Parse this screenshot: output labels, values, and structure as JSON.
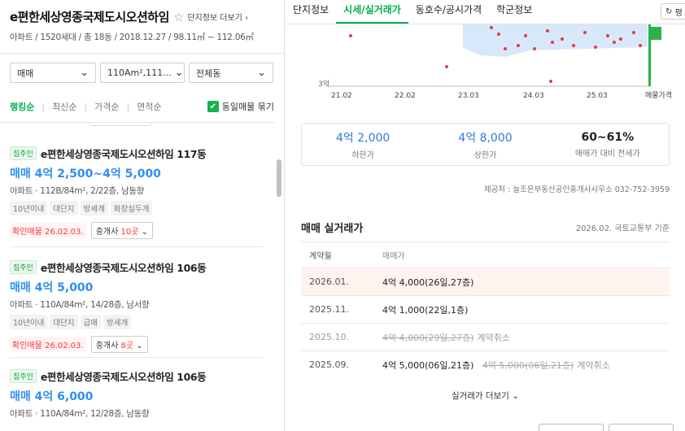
{
  "header": {
    "title": "e편한세상영종국제도시오션하임",
    "more_info": "단지정보 더보기",
    "sub_info": "아파트 / 1520세대 / 총 18동 / 2018.12.27 / 98.11㎡ ~ 112.06㎡"
  },
  "filters": {
    "trade": "매매",
    "area": "110Am²,111...",
    "dong": "전체동"
  },
  "sort": {
    "options": [
      "랭킹순",
      "최신순",
      "가격순",
      "면적순"
    ],
    "group_label": "동일매물 묶기"
  },
  "listings": [
    {
      "tag": "집주인",
      "name": "e편한세상영종국제도시오션하임 117동",
      "price": "매매 4억 2,500~4억 5,000",
      "spec": "아파트 · 112B/84m², 2/22층, 남동향",
      "chips": [
        "10년이내",
        "대단지",
        "방세개",
        "화장실두개"
      ],
      "confirm": "확인매물 26.02.03.",
      "agents_prefix": "중개사",
      "agents_count": "10곳"
    },
    {
      "tag": "집주인",
      "name": "e편한세상영종국제도시오션하임 106동",
      "price": "매매 4억 5,000",
      "spec": "아파트 · 110A/84m², 14/28층, 남서향",
      "chips": [
        "10년이내",
        "대단지",
        "급매",
        "방세개"
      ],
      "confirm": "확인매물 26.02.03.",
      "agents_prefix": "중개사",
      "agents_count": "8곳"
    },
    {
      "tag": "집주인",
      "name": "e편한세상영종국제도시오션하임 106동",
      "price": "매매 4억 6,000",
      "spec": "아파트 · 110A/84m², 12/28층, 남동향",
      "chips": [],
      "confirm": "",
      "agents_prefix": "",
      "agents_count": ""
    }
  ],
  "tabs": [
    "단지정보",
    "시세/실거래가",
    "동호수/공시가격",
    "학군정보"
  ],
  "refresh_label": "평",
  "chart": {
    "y_label": "3억",
    "x_ticks": [
      "21.02",
      "22.02",
      "23.03",
      "24.03",
      "25.03"
    ],
    "x_end_label": "매물가격",
    "accent": "#2cb34a",
    "dot_color": "#e83a3a",
    "band_color": "#d8e8fb"
  },
  "summary": [
    {
      "value": "4억 2,000",
      "label": "하한가"
    },
    {
      "value": "4억 8,000",
      "label": "상한가"
    },
    {
      "value": "60~61%",
      "label": "매매가 대비 전세가"
    }
  ],
  "provider": "제공처 : 늘조은부동산공인중개사사무소 032-752-3959",
  "deals": {
    "title": "매매 실거래가",
    "note": "2026.02. 국토교통부 기준",
    "col_date": "계약월",
    "col_price": "매매가",
    "rows": [
      {
        "date": "2026.01.",
        "price": "4억 4,000(26일,27층)",
        "struck": "",
        "cancel": ""
      },
      {
        "date": "2025.11.",
        "price": "4억 1,000(22일,1층)",
        "struck": "",
        "cancel": ""
      },
      {
        "date": "2025.10.",
        "price": "",
        "struck": "4억 4,000(29일,27층)",
        "cancel": "계약취소"
      },
      {
        "date": "2025.09.",
        "price": "4억 5,000(06일,21층)",
        "struck": "4억 5,000(06일,21층)",
        "cancel": "계약취소"
      }
    ],
    "more": "실거래가 더보기"
  }
}
